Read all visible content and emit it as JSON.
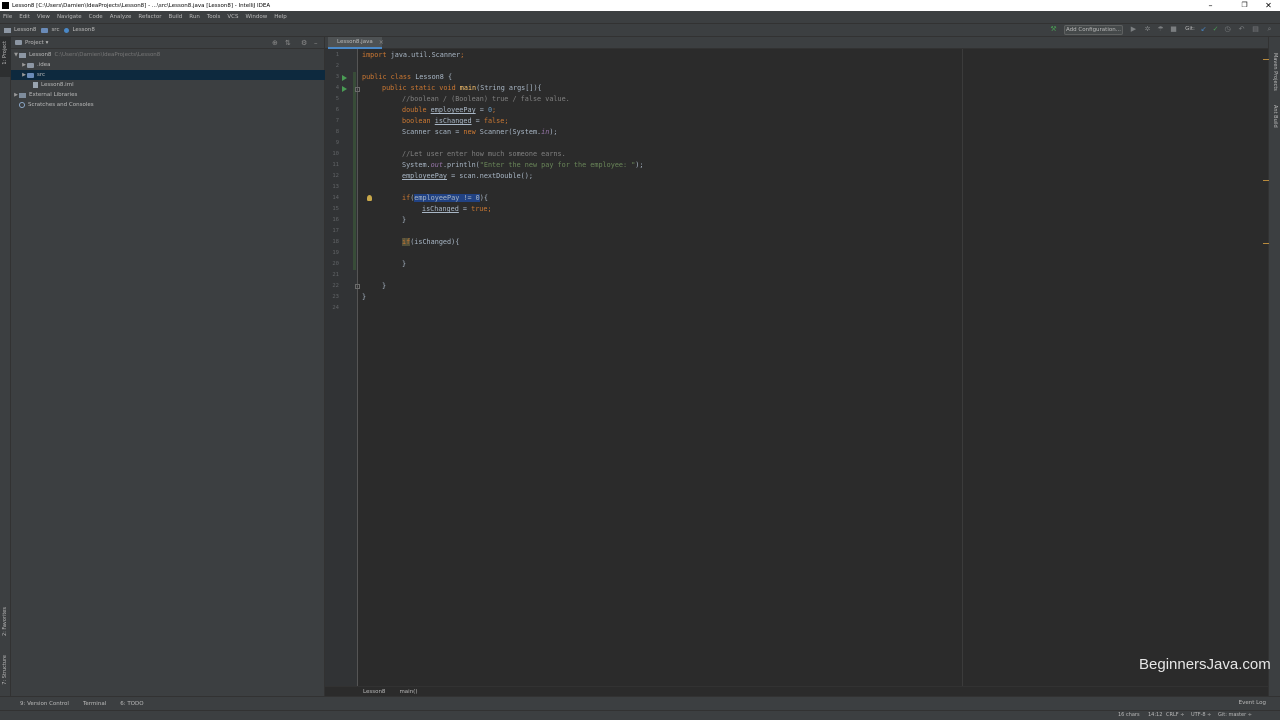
{
  "window": {
    "title": "Lesson8 [C:\\Users\\Damien\\IdeaProjects\\Lesson8] - ...\\src\\Lesson8.java [Lesson8] - IntelliJ IDEA",
    "controls": {
      "minimize": "–",
      "maximize": "❐",
      "close": "✕"
    }
  },
  "menu": [
    "File",
    "Edit",
    "View",
    "Navigate",
    "Code",
    "Analyze",
    "Refactor",
    "Build",
    "Run",
    "Tools",
    "VCS",
    "Window",
    "Help"
  ],
  "navbar": {
    "crumbs": [
      "Lesson8",
      "src",
      "Lesson8"
    ],
    "add_configuration": "Add Configuration...",
    "git_label": "Git:"
  },
  "project_panel": {
    "title": "Project ▾",
    "tree": [
      {
        "label": "Lesson8",
        "path": "C:\\Users\\Damien\\IdeaProjects\\Lesson8"
      },
      {
        "label": ".idea"
      },
      {
        "label": "src"
      },
      {
        "label": "Lesson8.iml"
      },
      {
        "label": "External Libraries"
      },
      {
        "label": "Scratches and Consoles"
      }
    ]
  },
  "left_tools": {
    "project": "1: Project",
    "favorites": "2: Favorites",
    "structure": "7: Structure"
  },
  "right_tools": {
    "maven": "Maven Projects",
    "ant": "Ant Build"
  },
  "editor": {
    "tab": "Lesson8.java",
    "tab_close": "×",
    "line_numbers": [
      "1",
      "2",
      "3",
      "4",
      "5",
      "6",
      "7",
      "8",
      "9",
      "10",
      "11",
      "12",
      "13",
      "14",
      "15",
      "16",
      "17",
      "18",
      "19",
      "20",
      "21",
      "22",
      "23",
      "24"
    ],
    "code": {
      "import_kw": "import",
      "import_pkg": " java.util.Scanner",
      "semi": ";",
      "public1": "public",
      "class_kw": " class",
      "class_name": " Lesson8 {",
      "public2": "public",
      "static_kw": " static",
      "void_kw": " void",
      "main_fn": " main",
      "main_args": "(String args[]){",
      "comment1": "//boolean / (Boolean) true / false value.",
      "double_kw": "double",
      "emp_var": "employeePay",
      "assign": " = ",
      "zero": "0",
      "boolean_kw": "boolean",
      "changed_var": "isChanged",
      "false_kw": "false",
      "scanner_decl": "Scanner scan = ",
      "new_kw": "new",
      "scanner_ctor": " Scanner(System.",
      "in_field": "in",
      "close_paren_semi": ");",
      "comment2": "//Let user enter how much someone earns.",
      "sysout_start": "System.",
      "out_field": "out",
      "println": ".println(",
      "prompt_str": "\"Enter the new pay for the employee: \"",
      "emp_assign_rest": " = scan.nextDouble();",
      "if_kw": "if",
      "open_paren": "(",
      "cond_sel": "employeePay != 0",
      "open_brace": "){",
      "changed_assign_rest": " = ",
      "true_kw": "true",
      "close_brace": "}",
      "if2_rest": "(isChanged){"
    }
  },
  "editor_breadcrumb": [
    "Lesson8",
    "main()"
  ],
  "bottom_tools": [
    "9: Version Control",
    "Terminal",
    "6: TODO"
  ],
  "event_log": "Event Log",
  "status": {
    "chars": "16 chars",
    "position": "14:12",
    "line_sep": "CRLF ÷",
    "encoding": "UTF-8 ÷",
    "git": "Git: master ÷"
  },
  "watermark": "BeginnersJava.com"
}
